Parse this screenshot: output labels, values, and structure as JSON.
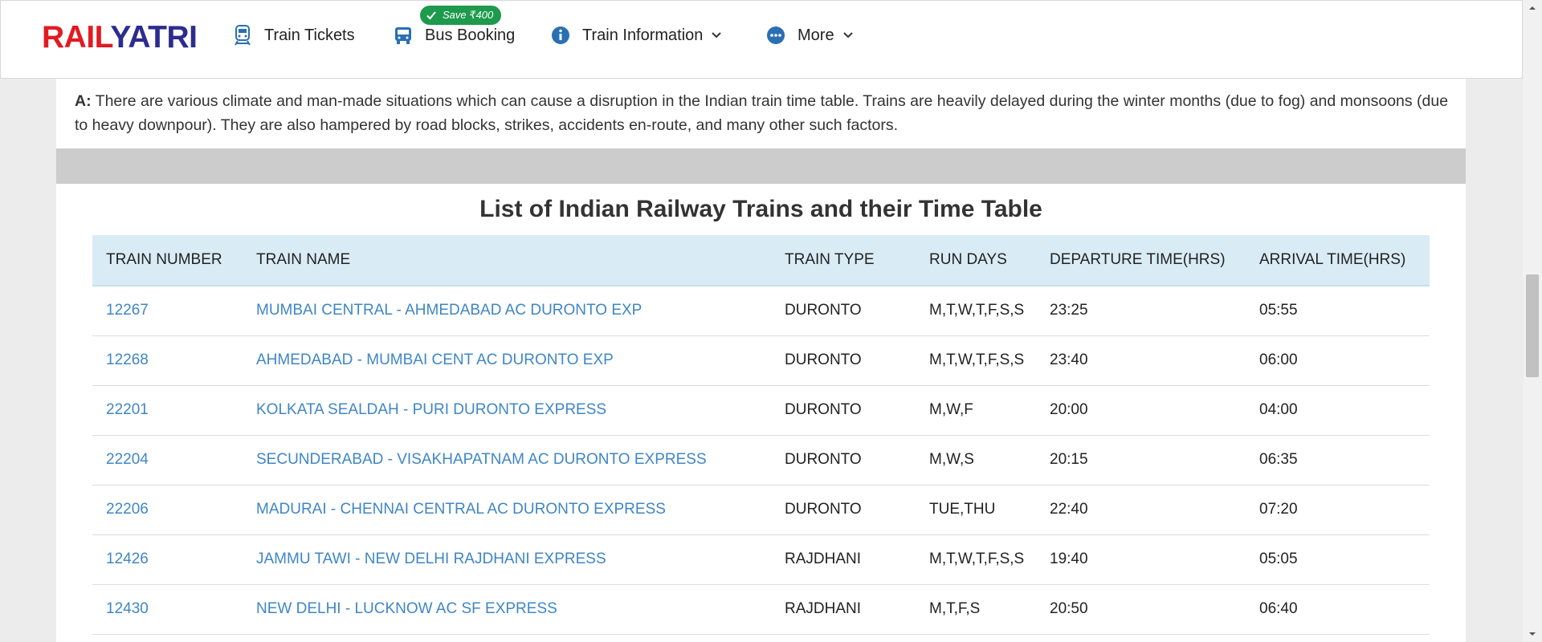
{
  "header": {
    "logo_part1": "RAIL",
    "logo_part2": "YATRI",
    "save_badge": "Save ₹400",
    "nav": [
      {
        "label": "Train Tickets",
        "icon": "train-icon"
      },
      {
        "label": "Bus Booking",
        "icon": "bus-icon"
      },
      {
        "label": "Train Information",
        "icon": "info-icon"
      },
      {
        "label": "More",
        "icon": "more-dots-icon"
      }
    ]
  },
  "faq": {
    "prefix": "A:",
    "text": "There are various climate and man-made situations which can cause a disruption in the Indian train time table. Trains are heavily delayed during the winter months (due to fog) and monsoons (due to heavy downpour). They are also hampered by road blocks, strikes, accidents en-route, and many other such factors."
  },
  "section_title": "List of Indian Railway Trains and their Time Table",
  "table": {
    "headers": [
      "TRAIN NUMBER",
      "TRAIN NAME",
      "TRAIN TYPE",
      "RUN DAYS",
      "DEPARTURE TIME(HRS)",
      "ARRIVAL TIME(HRS)"
    ],
    "rows": [
      [
        "12267",
        "MUMBAI CENTRAL - AHMEDABAD AC DURONTO EXP",
        "DURONTO",
        "M,T,W,T,F,S,S",
        "23:25",
        "05:55"
      ],
      [
        "12268",
        "AHMEDABAD - MUMBAI CENT AC DURONTO EXP",
        "DURONTO",
        "M,T,W,T,F,S,S",
        "23:40",
        "06:00"
      ],
      [
        "22201",
        "KOLKATA SEALDAH - PURI DURONTO EXPRESS",
        "DURONTO",
        "M,W,F",
        "20:00",
        "04:00"
      ],
      [
        "22204",
        "SECUNDERABAD - VISAKHAPATNAM AC DURONTO EXPRESS",
        "DURONTO",
        "M,W,S",
        "20:15",
        "06:35"
      ],
      [
        "22206",
        "MADURAI - CHENNAI CENTRAL AC DURONTO EXPRESS",
        "DURONTO",
        "TUE,THU",
        "22:40",
        "07:20"
      ],
      [
        "12426",
        "JAMMU TAWI - NEW DELHI RAJDHANI EXPRESS",
        "RAJDHANI",
        "M,T,W,T,F,S,S",
        "19:40",
        "05:05"
      ],
      [
        "12430",
        "NEW DELHI - LUCKNOW AC SF EXPRESS",
        "RAJDHANI",
        "M,T,F,S",
        "20:50",
        "06:40"
      ]
    ]
  },
  "colors": {
    "brand_red": "#e11b22",
    "brand_blue": "#2c2c8f",
    "link": "#3f86c6",
    "badge_green": "#1d9a4c",
    "header_bg": "#d9ecf5"
  }
}
